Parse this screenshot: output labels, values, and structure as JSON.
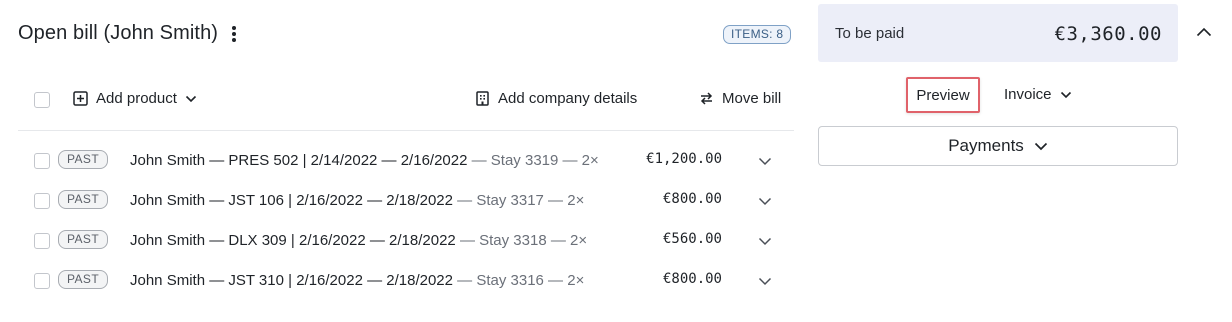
{
  "header": {
    "title": "Open bill (John Smith)",
    "items_badge": "ITEMS: 8"
  },
  "toolbar": {
    "add_product": "Add product",
    "add_company_details": "Add company details",
    "move_bill": "Move bill"
  },
  "rows": [
    {
      "status": "PAST",
      "main": "John Smith — PRES 502 | 2/14/2022 — 2/16/2022",
      "meta": " — Stay 3319 — 2×",
      "amount": "€1,200.00"
    },
    {
      "status": "PAST",
      "main": "John Smith — JST 106 | 2/16/2022 — 2/18/2022",
      "meta": " — Stay 3317 — 2×",
      "amount": "€800.00"
    },
    {
      "status": "PAST",
      "main": "John Smith — DLX 309 | 2/16/2022 — 2/18/2022",
      "meta": " — Stay 3318 — 2×",
      "amount": "€560.00"
    },
    {
      "status": "PAST",
      "main": "John Smith — JST 310 | 2/16/2022 — 2/18/2022",
      "meta": " — Stay 3316 — 2×",
      "amount": "€800.00"
    }
  ],
  "summary": {
    "label": "To be paid",
    "value": "€3,360.00"
  },
  "actions": {
    "preview": "Preview",
    "invoice": "Invoice",
    "payments": "Payments"
  },
  "colors": {
    "summary_bg": "#eceef8",
    "highlight_border": "#e0626a",
    "badge_border": "#7fa1c6"
  },
  "icons": {
    "menu": "more-vertical-icon",
    "add": "plus-square-icon",
    "company": "building-icon",
    "move": "swap-arrows-icon",
    "dropdown": "chevron-down-icon",
    "collapse": "chevron-up-icon"
  }
}
